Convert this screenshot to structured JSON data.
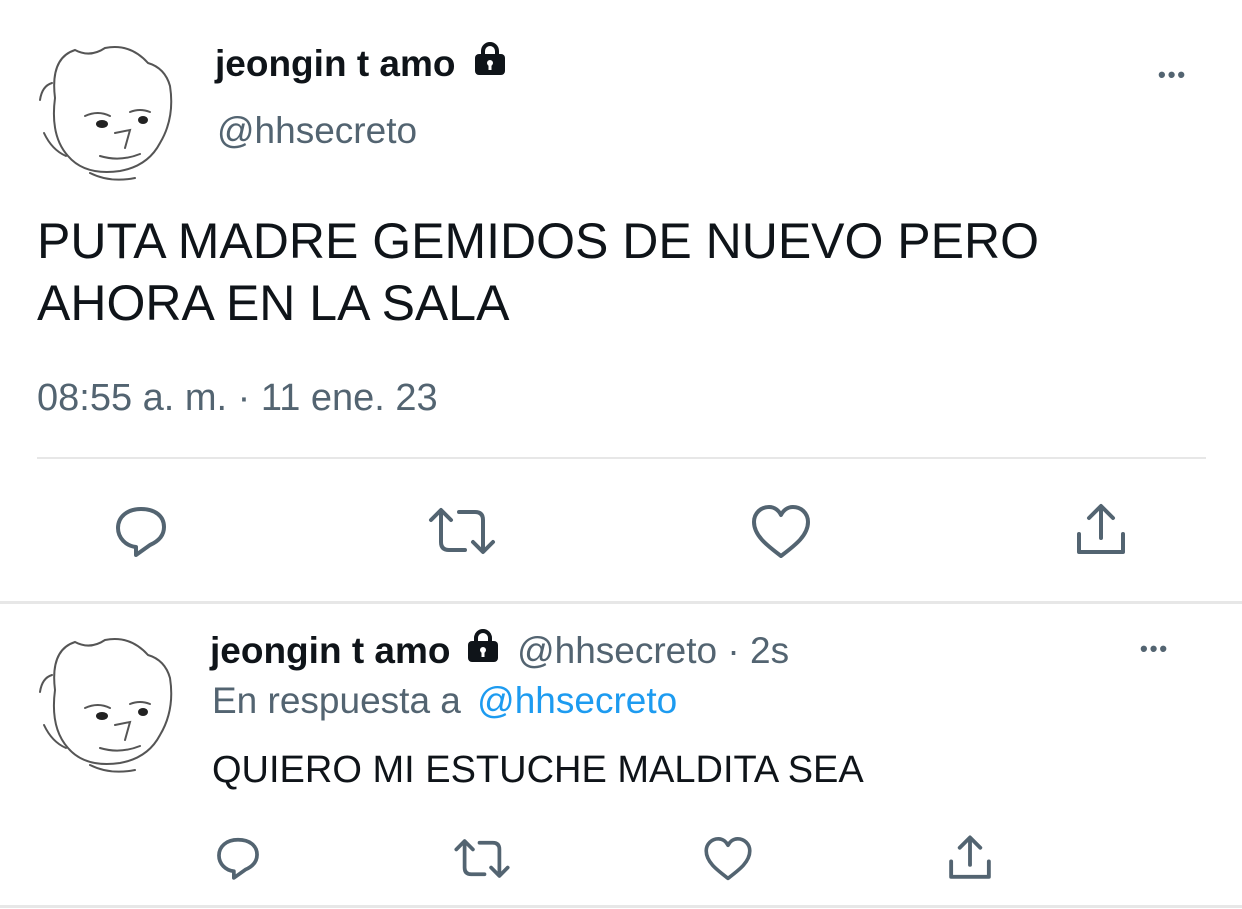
{
  "main_tweet": {
    "display_name": "jeongin t amo",
    "handle": "@hhsecreto",
    "text_line1": "PUTA MADRE GEMIDOS DE NUEVO PERO",
    "text_line2": "AHORA EN LA SALA",
    "timestamp": "08:55 a. m. · 11 ene. 23",
    "more_label": "•••"
  },
  "reply_tweet": {
    "display_name": "jeongin t amo",
    "handle_time": "@hhsecreto · 2s",
    "reply_prefix": "En respuesta a",
    "reply_to": "@hhsecreto",
    "text": "QUIERO MI ESTUCHE MALDITA SEA",
    "more_label": "•••"
  },
  "icons": [
    "avatar-cat-face",
    "lock-icon",
    "reply-icon",
    "retweet-icon",
    "like-icon",
    "share-icon",
    "more-icon"
  ],
  "colors": {
    "text": "#0f1419",
    "muted": "#536471",
    "link": "#1d9bf0",
    "divider": "#e7e7e7",
    "background": "#ffffff"
  }
}
